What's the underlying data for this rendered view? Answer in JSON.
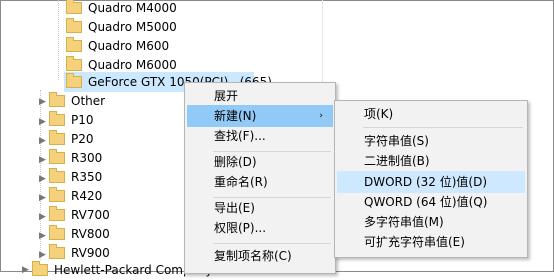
{
  "tree": {
    "items": [
      {
        "label": "Quadro M4000"
      },
      {
        "label": "Quadro M5000"
      },
      {
        "label": "Quadro M600"
      },
      {
        "label": "Quadro M6000"
      },
      {
        "label": "GeForce GTX 1050(PCI)...(665)"
      },
      {
        "label": "Other"
      },
      {
        "label": "P10"
      },
      {
        "label": "P20"
      },
      {
        "label": "R300"
      },
      {
        "label": "R350"
      },
      {
        "label": "R420"
      },
      {
        "label": "RV700"
      },
      {
        "label": "RV800"
      },
      {
        "label": "RV900"
      },
      {
        "label": "Hewlett-Packard Company"
      }
    ]
  },
  "context_menu": {
    "items": [
      {
        "label": "展开"
      },
      {
        "label": "新建(N)"
      },
      {
        "label": "查找(F)..."
      },
      {
        "label": "删除(D)"
      },
      {
        "label": "重命名(R)"
      },
      {
        "label": "导出(E)"
      },
      {
        "label": "权限(P)..."
      },
      {
        "label": "复制项名称(C)"
      }
    ],
    "submenu_arrow": "›"
  },
  "submenu": {
    "items": [
      {
        "label": "项(K)"
      },
      {
        "label": "字符串值(S)"
      },
      {
        "label": "二进制值(B)"
      },
      {
        "label": "DWORD (32 位)值(D)"
      },
      {
        "label": "QWORD (64 位)值(Q)"
      },
      {
        "label": "多字符串值(M)"
      },
      {
        "label": "可扩充字符串值(E)"
      }
    ]
  },
  "icons": {
    "folder": "folder-icon",
    "expand": "chevron-right-icon"
  },
  "colors": {
    "menu_bg": "#f2f2f2",
    "menu_highlight": "#91c9f7",
    "tree_selected": "#cce8ff",
    "folder": "#f4d17a"
  }
}
